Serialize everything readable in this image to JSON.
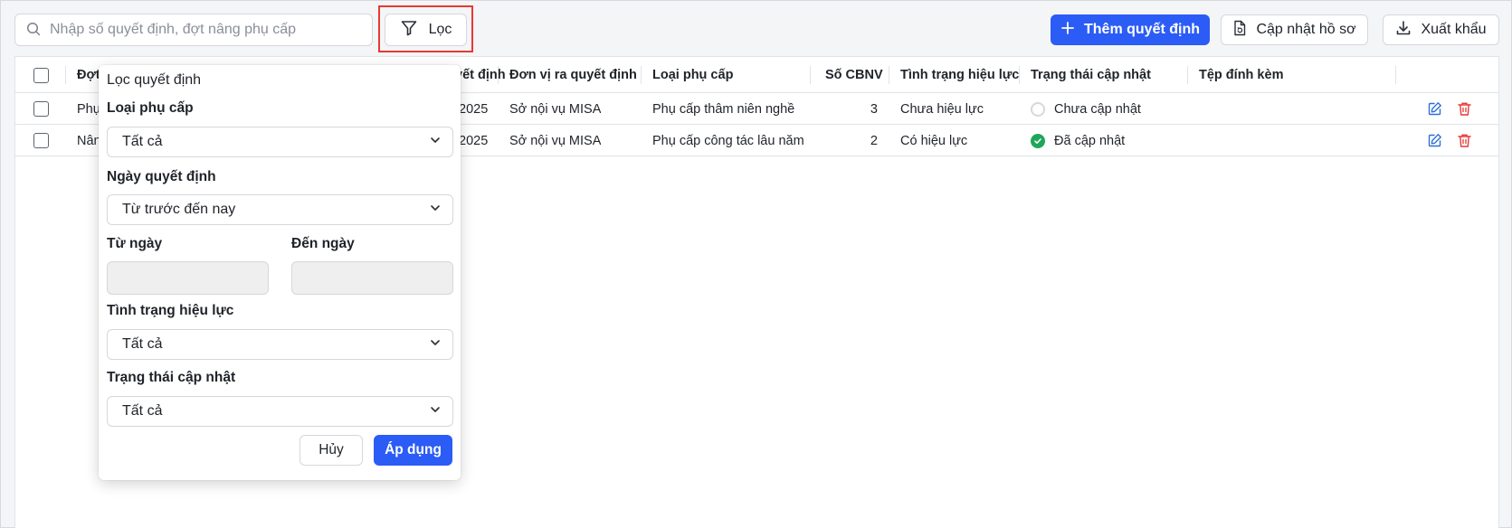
{
  "toolbar": {
    "search_placeholder": "Nhập số quyết định, đợt nâng phụ cấp",
    "filter_label": "Lọc",
    "add_label": "Thêm quyết định",
    "update_label": "Cập nhật hồ sơ",
    "export_label": "Xuất khẩu"
  },
  "table": {
    "headers": {
      "batch": "Đợt",
      "decision_date": "yết định",
      "issuer": "Đơn vị ra quyết định",
      "allowance_type": "Loại phụ cấp",
      "employee_count": "Số CBNV",
      "validity": "Tình trạng hiệu lực",
      "update_status": "Trạng thái cập nhật",
      "attachment": "Tệp đính kèm"
    },
    "rows": [
      {
        "batch": "Phụ",
        "decision_date": "/2025",
        "issuer": "Sở nội vụ MISA",
        "allowance_type": "Phụ cấp thâm niên nghề",
        "employee_count": "3",
        "validity": "Chưa hiệu lực",
        "update_status": "Chưa cập nhật",
        "status_kind": "pending"
      },
      {
        "batch": "Nân",
        "decision_date": "/2025",
        "issuer": "Sở nội vụ MISA",
        "allowance_type": "Phụ cấp công tác lâu năm",
        "employee_count": "2",
        "validity": "Có hiệu lực",
        "update_status": "Đã cập nhật",
        "status_kind": "done"
      }
    ]
  },
  "filter_popover": {
    "title": "Lọc quyết định",
    "allowance_type_label": "Loại phụ cấp",
    "allowance_type_value": "Tất cả",
    "decision_date_label": "Ngày quyết định",
    "decision_date_value": "Từ trước đến nay",
    "from_date_label": "Từ ngày",
    "to_date_label": "Đến ngày",
    "validity_label": "Tình trạng hiệu lực",
    "validity_value": "Tất cả",
    "update_status_label": "Trạng thái cập nhật",
    "update_status_value": "Tất cả",
    "cancel_label": "Hủy",
    "apply_label": "Áp dụng"
  },
  "colors": {
    "primary": "#2b5cf6",
    "success": "#1fa65a",
    "danger": "#e53935",
    "edit_icon": "#2f6fd6"
  },
  "icons": [
    "search-icon",
    "filter-icon",
    "plus-icon",
    "document-refresh-icon",
    "download-icon",
    "edit-icon",
    "trash-icon",
    "chevron-down-icon",
    "check-icon"
  ]
}
